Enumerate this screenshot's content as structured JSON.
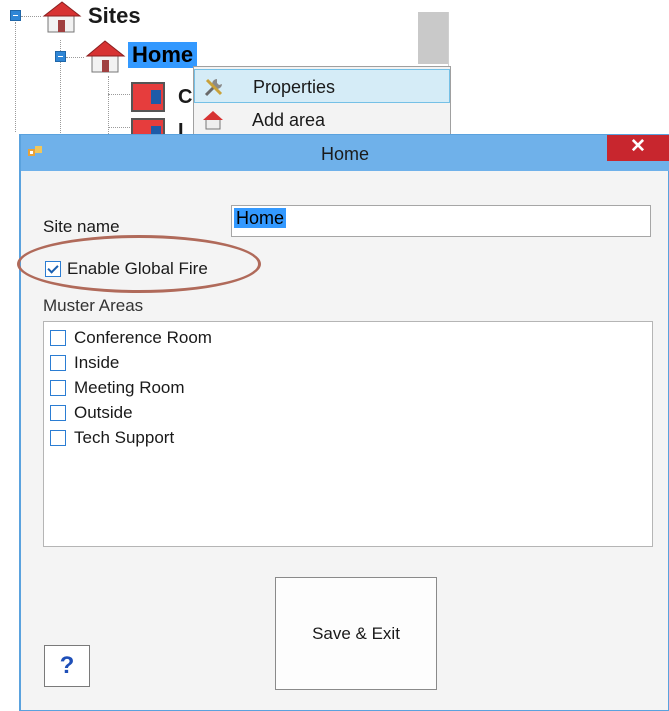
{
  "tree": {
    "sites_label": "Sites",
    "home_label": "Home",
    "child_label_1": "C",
    "child_label_2": "I"
  },
  "context_menu": {
    "items": [
      {
        "label": "Properties",
        "icon": "tools-icon"
      },
      {
        "label": "Add area",
        "icon": "house-icon"
      }
    ]
  },
  "dialog": {
    "title": "Home",
    "close_label": "✕",
    "site_name_label": "Site name",
    "site_name_value": "Home",
    "enable_global_fire_label": "Enable Global Fire",
    "enable_global_fire_checked": true,
    "muster_areas_label": "Muster Areas",
    "muster_areas": [
      {
        "label": "Conference Room",
        "checked": false
      },
      {
        "label": "Inside",
        "checked": false
      },
      {
        "label": "Meeting Room",
        "checked": false
      },
      {
        "label": "Outside",
        "checked": false
      },
      {
        "label": "Tech Support",
        "checked": false
      }
    ],
    "save_exit_label": "Save & Exit",
    "help_label": "?"
  },
  "colors": {
    "titlebar": "#6fb1ea",
    "close": "#c8262e",
    "selection": "#3399ff",
    "annotation_ellipse": "#b06a5a"
  }
}
